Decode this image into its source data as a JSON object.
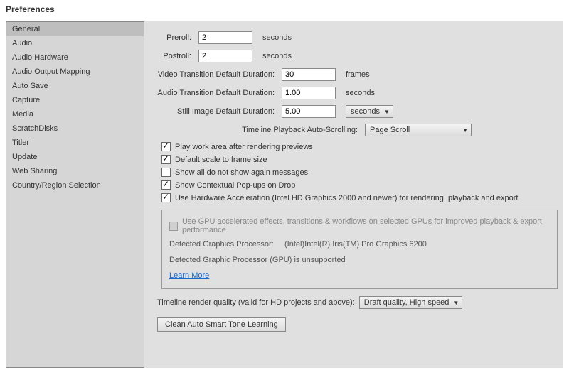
{
  "window_title": "Preferences",
  "sidebar": {
    "items": [
      {
        "label": "General",
        "selected": true
      },
      {
        "label": "Audio"
      },
      {
        "label": "Audio Hardware"
      },
      {
        "label": "Audio Output Mapping"
      },
      {
        "label": "Auto Save"
      },
      {
        "label": "Capture"
      },
      {
        "label": "Media"
      },
      {
        "label": "ScratchDisks"
      },
      {
        "label": "Titler"
      },
      {
        "label": "Update"
      },
      {
        "label": "Web Sharing"
      },
      {
        "label": "Country/Region Selection"
      }
    ]
  },
  "fields": {
    "preroll": {
      "label": "Preroll:",
      "value": "2",
      "unit": "seconds"
    },
    "postroll": {
      "label": "Postroll:",
      "value": "2",
      "unit": "seconds"
    },
    "video_trans": {
      "label": "Video Transition Default Duration:",
      "value": "30",
      "unit": "frames"
    },
    "audio_trans": {
      "label": "Audio Transition Default Duration:",
      "value": "1.00",
      "unit": "seconds"
    },
    "still_img": {
      "label": "Still Image Default Duration:",
      "value": "5.00",
      "unit_dropdown": "seconds"
    },
    "autoscroll": {
      "label": "Timeline Playback Auto-Scrolling:",
      "value": "Page Scroll"
    }
  },
  "checks": {
    "play_work_area": {
      "label": "Play work area after rendering previews",
      "checked": true
    },
    "default_scale": {
      "label": "Default scale to frame size",
      "checked": true
    },
    "show_all_dont": {
      "label": "Show all do not show again messages",
      "checked": false
    },
    "contextual_popups": {
      "label": "Show Contextual Pop-ups on Drop",
      "checked": true
    },
    "hw_accel": {
      "label": "Use Hardware Acceleration (Intel HD Graphics 2000 and newer) for rendering, playback and export",
      "checked": true
    }
  },
  "gpu": {
    "use_gpu": {
      "label": "Use GPU accelerated effects, transitions & workflows on selected GPUs for improved playback & export performance",
      "checked": false,
      "disabled": true
    },
    "detected_label": "Detected Graphics Processor:",
    "detected_value": "(Intel)Intel(R) Iris(TM) Pro Graphics 6200",
    "unsupported": "Detected Graphic Processor (GPU) is unsupported",
    "learn_more": "Learn More"
  },
  "render_quality": {
    "label": "Timeline render quality (valid for HD projects and above):",
    "value": "Draft quality, High speed"
  },
  "clean_btn": "Clean Auto Smart Tone Learning"
}
